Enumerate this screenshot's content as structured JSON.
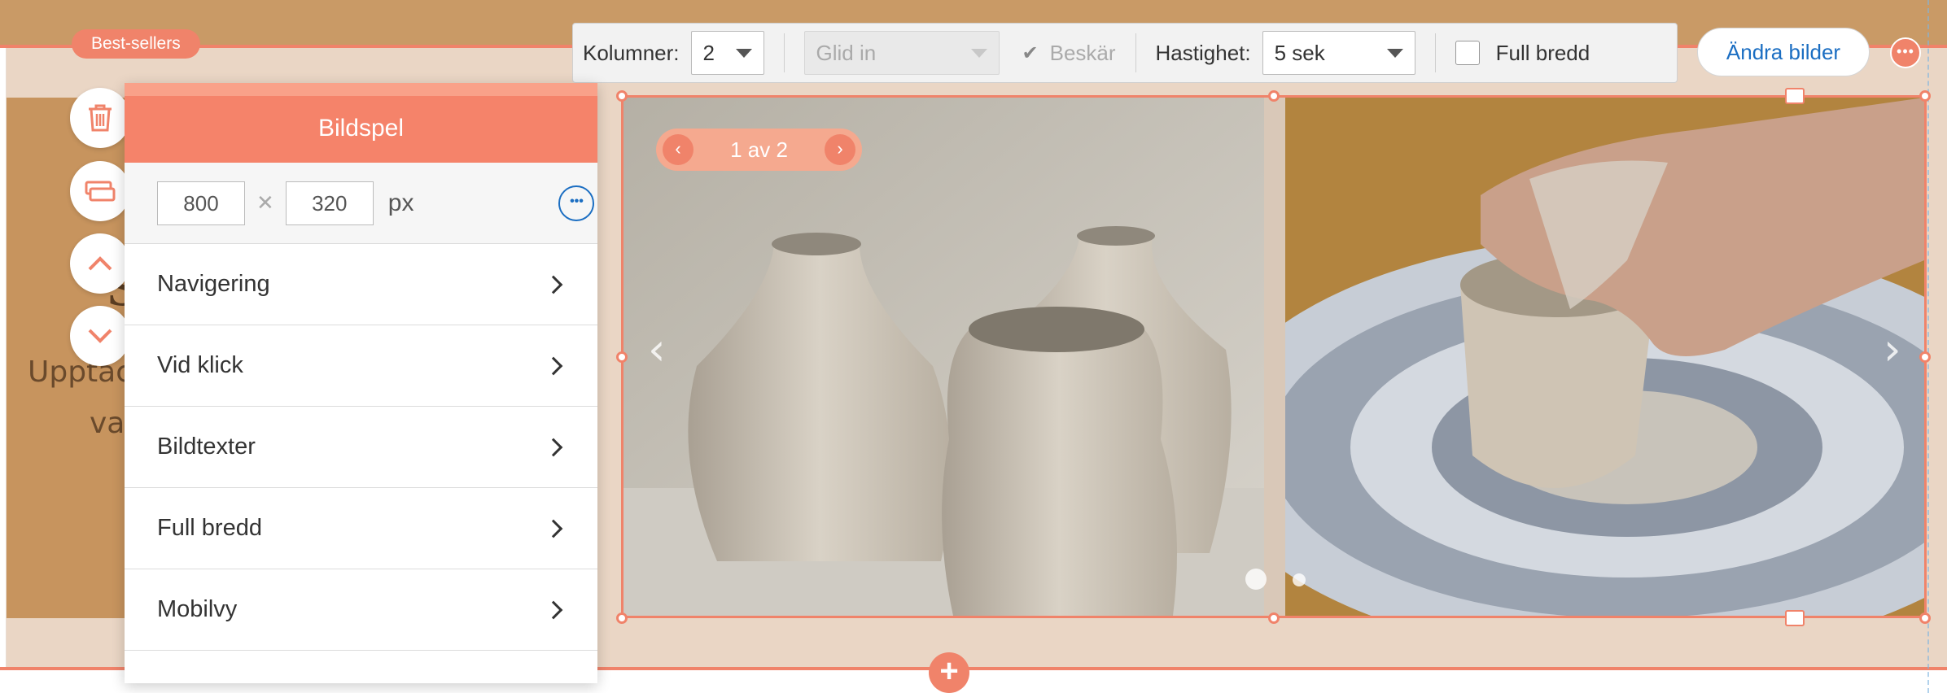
{
  "section_badge": "Best-sellers",
  "background_text": {
    "big_glyph": "S",
    "line1": "Upptäc",
    "line2": "vas"
  },
  "toolbar": {
    "columns_label": "Kolumner:",
    "columns_value": "2",
    "transition_value": "Glid in",
    "crop_label": "Beskär",
    "speed_label": "Hastighet:",
    "speed_value": "5 sek",
    "full_width_label": "Full bredd"
  },
  "change_images_button": "Ändra bilder",
  "panel": {
    "title": "Bildspel",
    "width": "800",
    "height": "320",
    "unit": "px",
    "items": [
      {
        "label": "Navigering"
      },
      {
        "label": "Vid klick"
      },
      {
        "label": "Bildtexter"
      },
      {
        "label": "Full bredd"
      },
      {
        "label": "Mobilvy"
      }
    ]
  },
  "slideshow": {
    "counter": "1 av 2",
    "current_slide": 1,
    "total_slides": 2
  },
  "colors": {
    "accent": "#f0836a",
    "link": "#1b6ec2",
    "section_bg": "#ead6c5"
  },
  "icons": {
    "delete": "trash-icon",
    "duplicate": "duplicate-icon",
    "move_up": "chevron-up-icon",
    "move_down": "chevron-down-icon",
    "more": "more-icon",
    "add": "plus-icon"
  }
}
